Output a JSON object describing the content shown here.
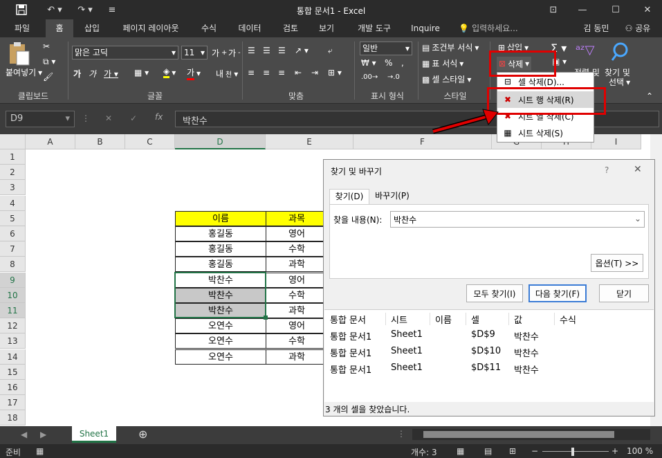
{
  "window": {
    "title": "통합 문서1  -  Excel"
  },
  "tabs": [
    "파일",
    "홈",
    "삽입",
    "페이지 레이아웃",
    "수식",
    "데이터",
    "검토",
    "보기",
    "개발 도구",
    "Inquire"
  ],
  "tell_me": "입력하세요...",
  "user": "김 동민",
  "share": "공유",
  "ribbon": {
    "paste": "붙여넣기",
    "font_name": "맑은 고딕",
    "font_size": "11",
    "number_format": "일반",
    "conditional": "조건부 서식",
    "table_format": "표 서식",
    "cell_style": "셀 스타일",
    "insert": "삽입",
    "delete": "삭제",
    "sort_filter": "정렬 및",
    "find_select": "찾기 및",
    "select": "선택",
    "groups": {
      "clipboard": "클립보드",
      "font": "글꼴",
      "align": "맞춤",
      "number": "표시 형식",
      "style": "스타일"
    }
  },
  "delete_menu": {
    "items": [
      "셀 삭제(D)...",
      "시트 행 삭제(R)",
      "시트 열 삭제(C)",
      "시트 삭제(S)"
    ]
  },
  "formula_bar": {
    "name_box": "D9",
    "value": "박찬수"
  },
  "columns": [
    "A",
    "B",
    "C",
    "D",
    "E",
    "F",
    "G",
    "H",
    "I"
  ],
  "rows": [
    "1",
    "2",
    "3",
    "4",
    "5",
    "6",
    "7",
    "8",
    "9",
    "10",
    "11",
    "12",
    "13",
    "14",
    "15",
    "16",
    "17",
    "18"
  ],
  "table": {
    "headers": [
      "이름",
      "과목"
    ],
    "rows": [
      [
        "홍길동",
        "영어"
      ],
      [
        "홍길동",
        "수학"
      ],
      [
        "홍길동",
        "과학"
      ],
      [
        "박찬수",
        "영어"
      ],
      [
        "박찬수",
        "수학"
      ],
      [
        "박찬수",
        "과학"
      ],
      [
        "오연수",
        "영어"
      ],
      [
        "오연수",
        "수학"
      ],
      [
        "오연수",
        "과학"
      ]
    ]
  },
  "find_dialog": {
    "title": "찾기 및 바꾸기",
    "tab_find": "찾기(D)",
    "tab_replace": "바꾸기(P)",
    "find_label": "찾을 내용(N):",
    "find_value": "박찬수",
    "options_btn": "옵션(T) >>",
    "find_all_btn": "모두 찾기(I)",
    "find_next_btn": "다음 찾기(F)",
    "close_btn": "닫기",
    "result_headers": [
      "통합 문서",
      "시트",
      "이름",
      "셀",
      "값",
      "수식"
    ],
    "results": [
      [
        "통합 문서1",
        "Sheet1",
        "",
        "$D$9",
        "박찬수",
        ""
      ],
      [
        "통합 문서1",
        "Sheet1",
        "",
        "$D$10",
        "박찬수",
        ""
      ],
      [
        "통합 문서1",
        "Sheet1",
        "",
        "$D$11",
        "박찬수",
        ""
      ]
    ],
    "status": "3 개의 셀을 찾았습니다."
  },
  "sheet_tab": "Sheet1",
  "status": {
    "ready": "준비",
    "count": "개수: 3",
    "zoom": "100 %"
  },
  "colors": {
    "accent_red": "#e00000",
    "header_yellow": "#ffff00",
    "excel_green": "#217346"
  }
}
